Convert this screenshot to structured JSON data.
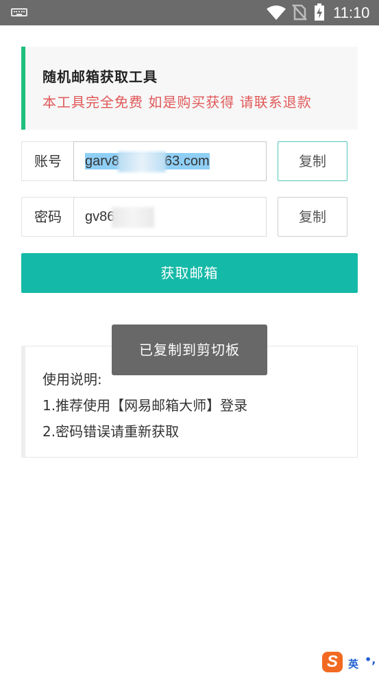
{
  "status_bar": {
    "time": "11:10",
    "icons": [
      "keyboard-icon",
      "wifi-icon",
      "no-sim-icon",
      "battery-charging-icon"
    ]
  },
  "header": {
    "title": "随机邮箱获取工具",
    "subtitle": "本工具完全免费 如是购买获得 请联系退款",
    "accent_color": "#1fbf7d",
    "subtitle_color": "#e05858"
  },
  "account": {
    "label": "账号",
    "value_prefix": "garv8",
    "value_suffix": "63.com",
    "copy_label": "复制"
  },
  "password": {
    "label": "密码",
    "value_prefix": "gv86",
    "copy_label": "复制"
  },
  "main_button": {
    "label": "获取邮箱",
    "color": "#15b9a7"
  },
  "instructions": {
    "heading": "使用说明:",
    "items": [
      "1.推荐使用【网易邮箱大师】登录",
      "2.密码错误请重新获取"
    ]
  },
  "toast": {
    "text": "已复制到剪切板"
  },
  "ime": {
    "logo": "S",
    "language": "英",
    "punct": "•,"
  }
}
